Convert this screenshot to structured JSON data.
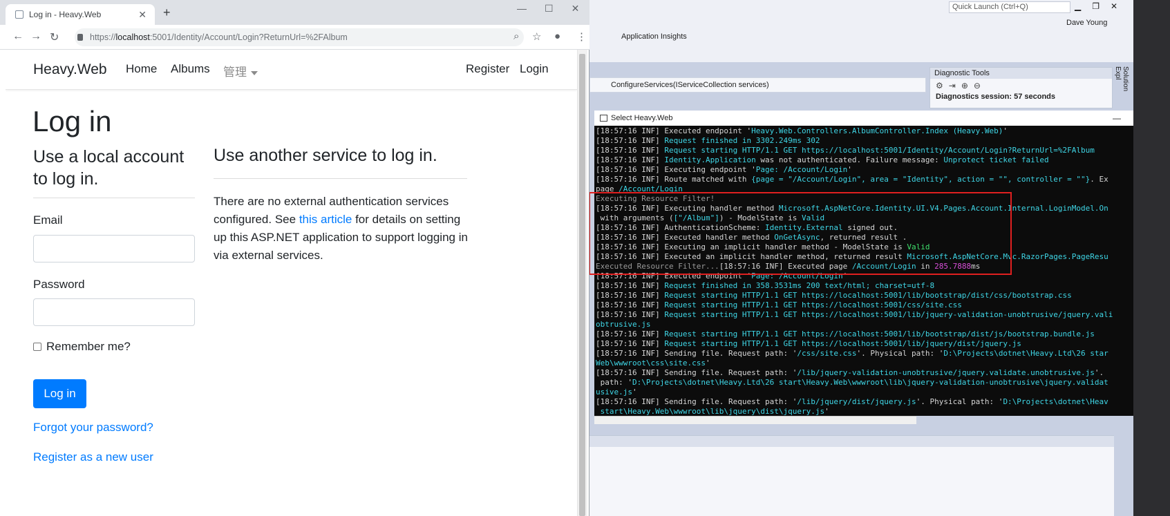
{
  "browser": {
    "tab_title": "Log in - Heavy.Web",
    "url_prefix": "https://",
    "url_host": "localhost",
    "url_rest": ":5001/Identity/Account/Login?ReturnUrl=%2FAlbum",
    "new_tab": "+",
    "tab_close": "✕"
  },
  "navbar": {
    "brand": "Heavy.Web",
    "links": [
      "Home",
      "Albums",
      "管理"
    ],
    "right_links": [
      "Register",
      "Login"
    ]
  },
  "page": {
    "title": "Log in",
    "local_heading": "Use a local account to log in.",
    "email_label": "Email",
    "email_value": "",
    "password_label": "Password",
    "password_value": "",
    "remember_label": "Remember me?",
    "login_button": "Log in",
    "forgot_link": "Forgot your password?",
    "register_link": "Register as a new user",
    "other_heading": "Use another service to log in.",
    "other_text_1": "There are no external authentication services configured. See ",
    "other_link": "this article",
    "other_text_2": " for details on setting up this ASP.NET application to support logging in via external services."
  },
  "vs": {
    "quick_launch": "Quick Launch (Ctrl+Q)",
    "user": "Dave Young",
    "app_insights": "Application Insights",
    "method_dropdown": "ConfigureServices(IServiceCollection services)",
    "diag_title": "Diagnostic Tools",
    "diag_session": "Diagnostics session: 57 seconds",
    "solution_explorer": "Solution Expl"
  },
  "console": {
    "title": "Select Heavy.Web",
    "lines": [
      [
        {
          "t": "[18:57:16 INF] Executed endpoint '"
        },
        {
          "t": "Heavy.Web.Controllers.AlbumController.Index (Heavy.Web)",
          "c": "c"
        },
        {
          "t": "'"
        }
      ],
      [
        {
          "t": "[18:57:16 INF] "
        },
        {
          "t": "Request finished in 3302.249ms 302",
          "c": "c"
        }
      ],
      [
        {
          "t": "[18:57:16 INF] "
        },
        {
          "t": "Request starting HTTP/1.1 GET https://localhost:5001/Identity/Account/Login?ReturnUrl=%2FAlbum",
          "c": "c"
        }
      ],
      [
        {
          "t": "[18:57:16 INF] "
        },
        {
          "t": "Identity.Application",
          "c": "c"
        },
        {
          "t": " was not authenticated. Failure message: "
        },
        {
          "t": "Unprotect ticket failed",
          "c": "c"
        }
      ],
      [
        {
          "t": "[18:57:16 INF] Executing endpoint '"
        },
        {
          "t": "Page: /Account/Login",
          "c": "c"
        },
        {
          "t": "'"
        }
      ],
      [
        {
          "t": "[18:57:16 INF] Route matched with "
        },
        {
          "t": "{page = \"/Account/Login\", area = \"Identity\", action = \"\", controller = \"\"}",
          "c": "c"
        },
        {
          "t": ". Ex"
        }
      ],
      [
        {
          "t": "page "
        },
        {
          "t": "/Account/Login",
          "c": "c"
        }
      ],
      [
        {
          "t": "Executing Resource Filter!",
          "c": "gr"
        }
      ],
      [
        {
          "t": "[18:57:16 INF] Executing handler method "
        },
        {
          "t": "Microsoft.AspNetCore.Identity.UI.V4.Pages.Account.Internal.LoginModel.On",
          "c": "c"
        }
      ],
      [
        {
          "t": " with arguments ("
        },
        {
          "t": "[\"/Album\"]",
          "c": "c"
        },
        {
          "t": ") - ModelState is "
        },
        {
          "t": "Valid",
          "c": "c"
        }
      ],
      [
        {
          "t": "[18:57:16 INF] AuthenticationScheme: "
        },
        {
          "t": "Identity.External",
          "c": "c"
        },
        {
          "t": " signed out."
        }
      ],
      [
        {
          "t": "[18:57:16 INF] Executed handler method "
        },
        {
          "t": "OnGetAsync",
          "c": "c"
        },
        {
          "t": ", returned result ."
        }
      ],
      [
        {
          "t": "[18:57:16 INF] Executing an implicit handler method - ModelState is "
        },
        {
          "t": "Valid",
          "c": "g"
        }
      ],
      [
        {
          "t": "[18:57:16 INF] Executed an implicit handler method, returned result "
        },
        {
          "t": "Microsoft.AspNetCore.Mvc.RazorPages.PageResu",
          "c": "c"
        }
      ],
      [
        {
          "t": "Executed Resource Filter...",
          "c": "gr"
        },
        {
          "t": "[18:57:16 INF] Executed page "
        },
        {
          "t": "/Account/Login",
          "c": "c"
        },
        {
          "t": " in "
        },
        {
          "t": "285.7888",
          "c": "m"
        },
        {
          "t": "ms"
        }
      ],
      [
        {
          "t": "[18:57:16 INF] Executed endpoint '"
        },
        {
          "t": "Page: /Account/Login",
          "c": "c"
        },
        {
          "t": "'"
        }
      ],
      [
        {
          "t": "[18:57:16 INF] "
        },
        {
          "t": "Request finished in 358.3531ms 200 text/html; charset=utf-8",
          "c": "c"
        }
      ],
      [
        {
          "t": "[18:57:16 INF] "
        },
        {
          "t": "Request starting HTTP/1.1 GET https://localhost:5001/lib/bootstrap/dist/css/bootstrap.css",
          "c": "c"
        }
      ],
      [
        {
          "t": "[18:57:16 INF] "
        },
        {
          "t": "Request starting HTTP/1.1 GET https://localhost:5001/css/site.css",
          "c": "c"
        }
      ],
      [
        {
          "t": "[18:57:16 INF] "
        },
        {
          "t": "Request starting HTTP/1.1 GET https://localhost:5001/lib/jquery-validation-unobtrusive/jquery.vali",
          "c": "c"
        }
      ],
      [
        {
          "t": "obtrusive.js",
          "c": "c"
        }
      ],
      [
        {
          "t": "[18:57:16 INF] "
        },
        {
          "t": "Request starting HTTP/1.1 GET https://localhost:5001/lib/bootstrap/dist/js/bootstrap.bundle.js",
          "c": "c"
        }
      ],
      [
        {
          "t": "[18:57:16 INF] "
        },
        {
          "t": "Request starting HTTP/1.1 GET https://localhost:5001/lib/jquery/dist/jquery.js",
          "c": "c"
        }
      ],
      [
        {
          "t": "[18:57:16 INF] Sending file. Request path: '"
        },
        {
          "t": "/css/site.css",
          "c": "c"
        },
        {
          "t": "'. Physical path: '"
        },
        {
          "t": "D:\\Projects\\dotnet\\Heavy.Ltd\\26 star",
          "c": "c"
        }
      ],
      [
        {
          "t": "Web\\wwwroot\\css\\site.css",
          "c": "c"
        },
        {
          "t": "'"
        }
      ],
      [
        {
          "t": "[18:57:16 INF] Sending file. Request path: '"
        },
        {
          "t": "/lib/jquery-validation-unobtrusive/jquery.validate.unobtrusive.js",
          "c": "c"
        },
        {
          "t": "'."
        }
      ],
      [
        {
          "t": " path: '"
        },
        {
          "t": "D:\\Projects\\dotnet\\Heavy.Ltd\\26 start\\Heavy.Web\\wwwroot\\lib\\jquery-validation-unobtrusive\\jquery.validat",
          "c": "c"
        }
      ],
      [
        {
          "t": "usive.js",
          "c": "c"
        },
        {
          "t": "'"
        }
      ],
      [
        {
          "t": "[18:57:16 INF] Sending file. Request path: '"
        },
        {
          "t": "/lib/jquery/dist/jquery.js",
          "c": "c"
        },
        {
          "t": "'. Physical path: '"
        },
        {
          "t": "D:\\Projects\\dotnet\\Heav",
          "c": "c"
        }
      ],
      [
        {
          "t": " start\\Heavy.Web\\wwwroot\\lib\\jquery\\dist\\jquery.js",
          "c": "c"
        },
        {
          "t": "'"
        }
      ]
    ]
  }
}
